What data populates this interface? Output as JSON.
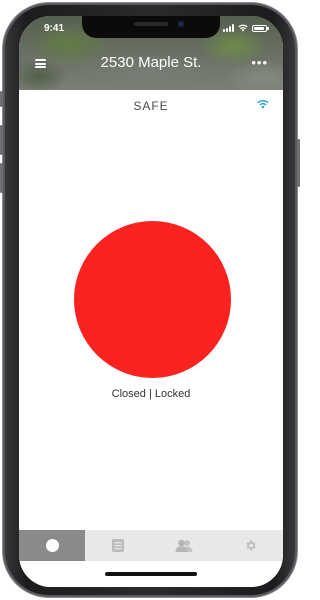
{
  "status_bar": {
    "time": "9:41"
  },
  "header": {
    "address": "2530 Maple St.",
    "more_label": "•••"
  },
  "main": {
    "state_title": "SAFE",
    "lock_status": "Closed | Locked",
    "lock_color": "#fa2320",
    "accent_color": "#1aa3c6"
  },
  "tab_bar": {
    "tabs": [
      {
        "name": "status",
        "icon": "dot-icon",
        "active": true
      },
      {
        "name": "history",
        "icon": "list-icon",
        "active": false
      },
      {
        "name": "users",
        "icon": "users-icon",
        "active": false
      },
      {
        "name": "settings",
        "icon": "gear-icon",
        "active": false
      }
    ]
  }
}
